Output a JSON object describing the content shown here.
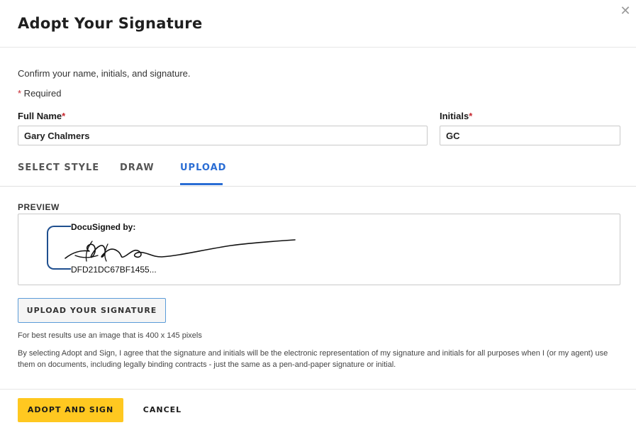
{
  "dialog": {
    "title": "Adopt Your Signature",
    "close_icon": "close-icon"
  },
  "form": {
    "instructions": "Confirm your name, initials, and signature.",
    "required_marker": "*",
    "required_text": " Required",
    "full_name_label": "Full Name",
    "full_name_value": "Gary Chalmers",
    "initials_label": "Initials",
    "initials_value": "GC"
  },
  "tabs": [
    {
      "label": "SELECT STYLE",
      "active": false
    },
    {
      "label": "DRAW",
      "active": false
    },
    {
      "label": "UPLOAD",
      "active": true
    }
  ],
  "preview": {
    "label": "PREVIEW",
    "signed_by_text": "DocuSigned by:",
    "envelope_id": "DFD21DC67BF1455..."
  },
  "upload": {
    "button_label": "UPLOAD YOUR SIGNATURE",
    "hint": "For best results use an image that is 400 x 145 pixels"
  },
  "legal_text": "By selecting Adopt and Sign, I agree that the signature and initials will be the electronic representation of my signature and initials for all purposes when I (or my agent) use them on documents, including legally binding contracts - just the same as a pen-and-paper signature or initial.",
  "footer": {
    "adopt_label": "ADOPT AND SIGN",
    "cancel_label": "CANCEL"
  },
  "colors": {
    "accent": "#2a6dd4",
    "primary_button": "#ffc820",
    "required": "#c6262e",
    "docusign_bracket": "#1f4f8f"
  }
}
